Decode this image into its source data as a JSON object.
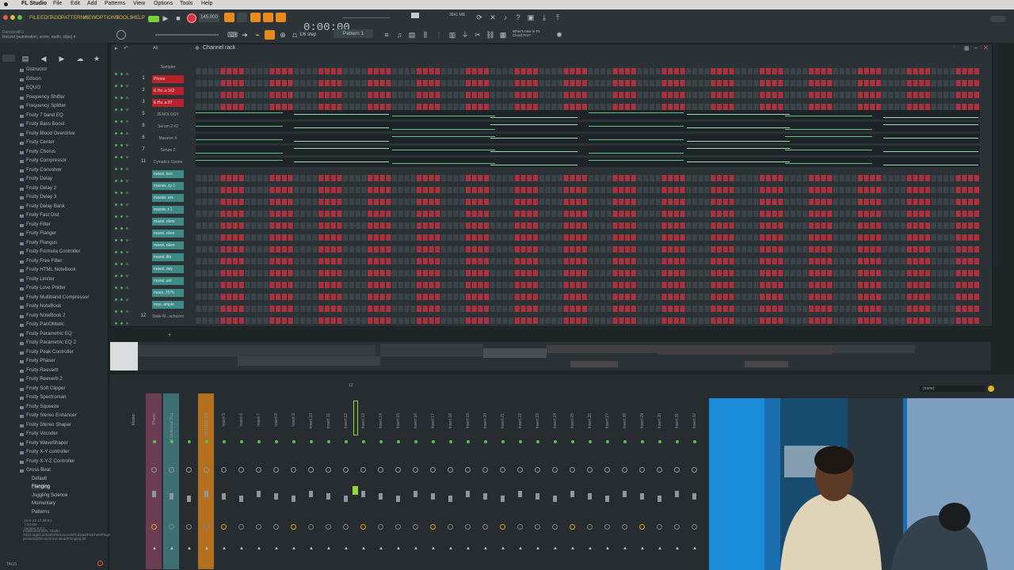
{
  "menubar": {
    "app": "FL Studio",
    "items": [
      "File",
      "Edit",
      "Add",
      "Patterns",
      "View",
      "Options",
      "Tools",
      "Help"
    ]
  },
  "toolbar": {
    "menus": [
      "FILE",
      "EDIT",
      "ADD",
      "PATTERNS",
      "VIEW",
      "OPTIONS",
      "TOOLS",
      "HELP"
    ],
    "tempo": "145.000",
    "time": "0:00:00",
    "snap": "1/6 step",
    "pattern": "Pattern 1",
    "cpu_mem": "3841 MB",
    "news": "What's new in FL Cloud Pro?",
    "hint_title": "DaredevilFu",
    "hint": "Record (automation, score, audio, clips) it"
  },
  "browser": {
    "items": [
      "Distructor",
      "Edison",
      "EQUO",
      "Frequency Shifter",
      "Frequency Splitter",
      "Fruity 7 band EQ",
      "Fruity Bass Boost",
      "Fruity Blood Overdrive",
      "Fruity Center",
      "Fruity Chorus",
      "Fruity Compressor",
      "Fruity Convolver",
      "Fruity Delay",
      "Fruity Delay 2",
      "Fruity Delay 3",
      "Fruity Delay Bank",
      "Fruity Fast Dist",
      "Fruity Filter",
      "Fruity Flanger",
      "Fruity Flangus",
      "Fruity Formula Controller",
      "Fruity Free Filter",
      "Fruity HTML NoteBook",
      "Fruity Limiter",
      "Fruity Love Philter",
      "Fruity Multiband Compressor",
      "Fruity NoteBook",
      "Fruity NoteBook 2",
      "Fruity PanOMatic",
      "Fruity Parametric EQ",
      "Fruity Parametric EQ 2",
      "Fruity Peak Controller",
      "Fruity Phaser",
      "Fruity Reeverb",
      "Fruity Reeverb 2",
      "Fruity Soft Clipper",
      "Fruity Spectroman",
      "Fruity Squeeze",
      "Fruity Stereo Enhancer",
      "Fruity Stereo Shaper",
      "Fruity Vocoder",
      "Fruity WaveShaper",
      "Fruity X-Y controller",
      "Fruity X-Y-Z Controller",
      "Gross Beat"
    ],
    "sub_items": [
      "Default",
      "Flanging",
      "Juggling Science",
      "Momentary",
      "Patterns"
    ],
    "footer_date": "16-5-23 17:38:54",
    "footer_size": "7.34 KB",
    "footer_version": "Version 8.0.2",
    "footer_path": "/Applications/FL Studio 2024.app/Contents/Resources/FL/Data/Patches/Plugin presets/Effects/Gross Beat/Flanging.fst",
    "tags": "TAGS"
  },
  "rack": {
    "title": "Channel rack",
    "filter": "All",
    "channels": [
      {
        "num": "",
        "name": "Sampler",
        "style": "plain",
        "kind": "steps"
      },
      {
        "num": "1",
        "name": "Phone",
        "style": "red",
        "kind": "steps"
      },
      {
        "num": "2",
        "name": "E.Ho..a 162",
        "style": "red",
        "kind": "steps"
      },
      {
        "num": "3",
        "name": "E.Ho..a 87",
        "style": "red",
        "kind": "steps"
      },
      {
        "num": "5",
        "name": "ZENOLOGY",
        "style": "plain",
        "kind": "roll"
      },
      {
        "num": "8",
        "name": "Serum 2 #2",
        "style": "plain",
        "kind": "roll"
      },
      {
        "num": "6",
        "name": "Massive X",
        "style": "plain",
        "kind": "roll"
      },
      {
        "num": "7",
        "name": "Serum 2",
        "style": "plain",
        "kind": "roll"
      },
      {
        "num": "11",
        "name": "Cymatics Ozone",
        "style": "plain",
        "kind": "roll"
      },
      {
        "num": "",
        "name": "massi..kee",
        "style": "teal",
        "kind": "steps"
      },
      {
        "num": "",
        "name": "massiv..cy 1",
        "style": "teal",
        "kind": "steps"
      },
      {
        "num": "",
        "name": "massiv..ars",
        "style": "teal",
        "kind": "steps"
      },
      {
        "num": "",
        "name": "massiv..t 1",
        "style": "teal",
        "kind": "steps"
      },
      {
        "num": "",
        "name": "massi..nkee",
        "style": "teal",
        "kind": "steps"
      },
      {
        "num": "",
        "name": "massi..nkee",
        "style": "teal",
        "kind": "steps"
      },
      {
        "num": "",
        "name": "massi..nkee",
        "style": "teal",
        "kind": "steps"
      },
      {
        "num": "",
        "name": "massi..ilfa",
        "style": "teal",
        "kind": "steps"
      },
      {
        "num": "",
        "name": "massi..ney",
        "style": "teal",
        "kind": "steps"
      },
      {
        "num": "",
        "name": "massi..anl",
        "style": "teal",
        "kind": "steps"
      },
      {
        "num": "",
        "name": "mass..7070",
        "style": "teal",
        "kind": "steps"
      },
      {
        "num": "",
        "name": "mas..ample",
        "style": "teal",
        "kind": "steps"
      },
      {
        "num": "12",
        "name": "State M...achuzes",
        "style": "plain",
        "kind": "steps"
      }
    ]
  },
  "mixer": {
    "selector": "(none)",
    "master_label": "Master",
    "strip_labels": [
      "Phone",
      "X.Universal Tug",
      "",
      "MELODY FX",
      "Insert 5",
      "Insert 6",
      "Insert 7",
      "Insert 8",
      "Insert 9",
      "Insert 10",
      "Insert 11",
      "Insert 12",
      "Insert 13",
      "Insert 14",
      "Insert 15",
      "Insert 16",
      "Insert 17",
      "Insert 18",
      "Insert 19",
      "Insert 20",
      "Insert 21",
      "Insert 22",
      "Insert 23",
      "Insert 24",
      "Insert 25",
      "Insert 26",
      "Insert 27",
      "Insert 28",
      "Insert 29",
      "Insert 30",
      "Insert 31",
      "Insert 32"
    ],
    "marker": "12"
  },
  "colors": {
    "step_red": "#a8323e",
    "step_dark": "#3b4448",
    "accent_green": "#9bd33e",
    "rec": "#d93340",
    "orange": "#e88a1e"
  }
}
